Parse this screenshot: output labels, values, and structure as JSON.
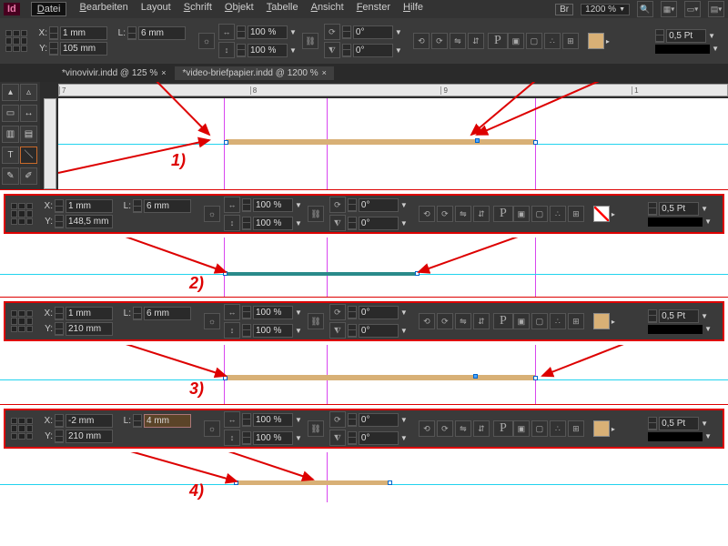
{
  "app": {
    "logo": "Id"
  },
  "menu": [
    "Datei",
    "Bearbeiten",
    "Layout",
    "Schrift",
    "Objekt",
    "Tabelle",
    "Ansicht",
    "Fenster",
    "Hilfe"
  ],
  "header": {
    "br": "Br",
    "zoom": "1200 %",
    "dropdown_glyph": "▼"
  },
  "tabs": [
    {
      "label": "*vinovivir.indd @ 125 %",
      "active": false
    },
    {
      "label": "*video-briefpapier.indd @ 1200 %",
      "active": true
    }
  ],
  "ruler_ticks": [
    "7",
    "",
    "8",
    "",
    "9",
    "",
    "1"
  ],
  "steps": [
    {
      "num": "1)",
      "x": "1 mm",
      "y": "105 mm",
      "l": "6 mm",
      "scale": "100 %",
      "rot": "0°",
      "stroke": "0,5 Pt",
      "fill": "orange"
    },
    {
      "num": "2)",
      "x": "1 mm",
      "y": "148,5 mm",
      "l": "6 mm",
      "scale": "100 %",
      "rot": "0°",
      "stroke": "0,5 Pt",
      "fill": "none"
    },
    {
      "num": "3)",
      "x": "1 mm",
      "y": "210 mm",
      "l": "6 mm",
      "scale": "100 %",
      "rot": "0°",
      "stroke": "0,5 Pt",
      "fill": "orange"
    },
    {
      "num": "4)",
      "x": "-2 mm",
      "y": "210 mm",
      "l": "4 mm",
      "scale": "100 %",
      "rot": "0°",
      "stroke": "0,5 Pt",
      "fill": "orange",
      "l_hl": true
    }
  ],
  "labels": {
    "x": "X:",
    "y": "Y:",
    "l": "L:"
  },
  "icons": {
    "arrow": "▸"
  }
}
